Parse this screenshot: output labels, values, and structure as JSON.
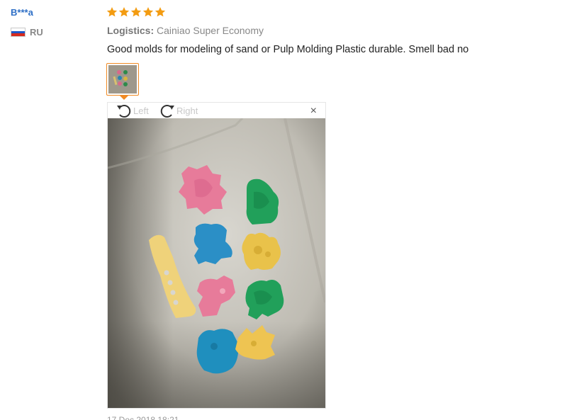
{
  "reviewer": {
    "name": "B***a",
    "country_code": "RU",
    "flag_colors": [
      "#ffffff",
      "#1c57c9",
      "#d52b1e"
    ]
  },
  "rating": {
    "stars": 5,
    "max": 5,
    "color": "#f39c12"
  },
  "logistics": {
    "label": "Logistics:",
    "value": "Cainiao Super Economy"
  },
  "review": {
    "text": "Good molds for modeling of sand or Pulp Molding Plastic durable. Smell bad no"
  },
  "viewer": {
    "rotate_left_label": "Left",
    "rotate_right_label": "Right",
    "close_label": "×",
    "accent_color": "#f08a24"
  },
  "date": {
    "text": "17 Dec 2018 18:21"
  }
}
